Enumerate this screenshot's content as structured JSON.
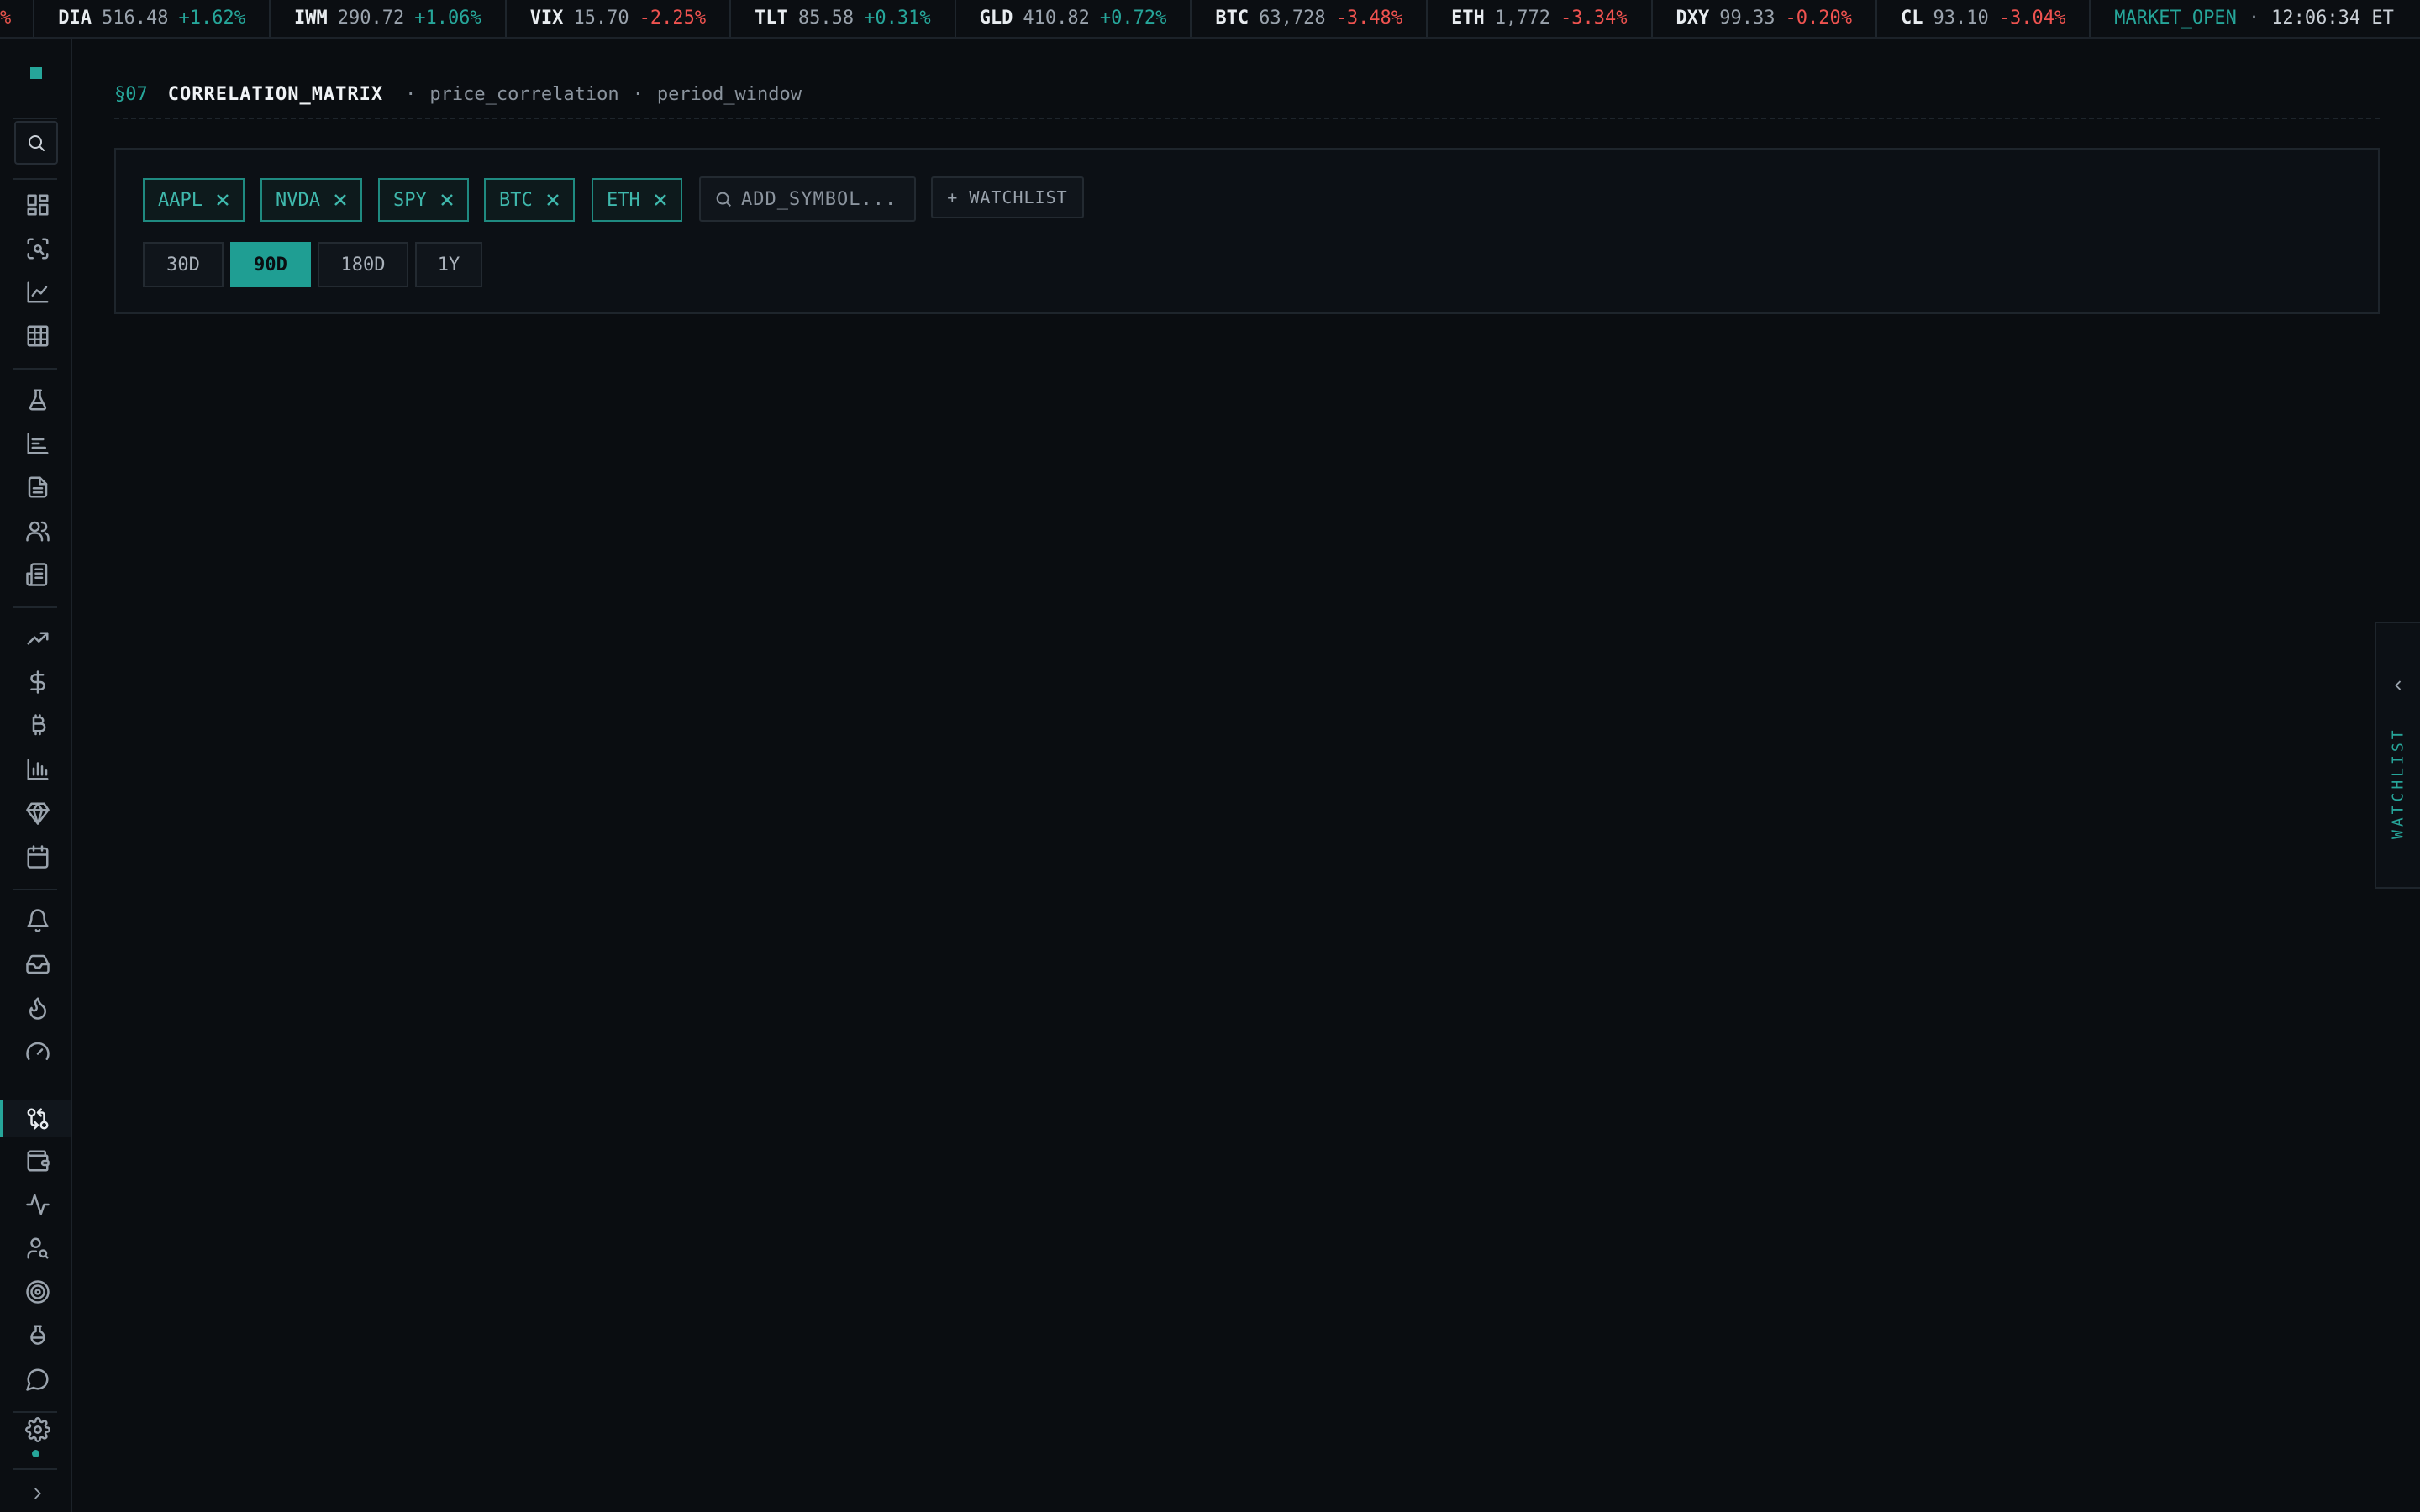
{
  "ticker": {
    "fragment": "%",
    "items": [
      {
        "symbol": "DIA",
        "price": "516.48",
        "change": "+1.62%",
        "dir": "up"
      },
      {
        "symbol": "IWM",
        "price": "290.72",
        "change": "+1.06%",
        "dir": "up"
      },
      {
        "symbol": "VIX",
        "price": "15.70",
        "change": "-2.25%",
        "dir": "down"
      },
      {
        "symbol": "TLT",
        "price": "85.58",
        "change": "+0.31%",
        "dir": "up"
      },
      {
        "symbol": "GLD",
        "price": "410.82",
        "change": "+0.72%",
        "dir": "up"
      },
      {
        "symbol": "BTC",
        "price": "63,728",
        "change": "-3.48%",
        "dir": "down"
      },
      {
        "symbol": "ETH",
        "price": "1,772",
        "change": "-3.34%",
        "dir": "down"
      },
      {
        "symbol": "DXY",
        "price": "99.33",
        "change": "-0.20%",
        "dir": "down"
      },
      {
        "symbol": "CL",
        "price": "93.10",
        "change": "-3.04%",
        "dir": "down"
      }
    ],
    "market_status": "MARKET_OPEN",
    "separator": "·",
    "time": "12:06:34 ET"
  },
  "sidebar": {
    "icons": [
      "dashboard-icon",
      "scan-search-icon",
      "line-chart-icon",
      "grid-table-icon",
      "flask-icon",
      "bar-list-icon",
      "document-icon",
      "users-icon",
      "news-icon",
      "trending-up-icon",
      "dollar-icon",
      "bitcoin-icon",
      "bar-chart-icon",
      "gem-icon",
      "calendar-icon",
      "bell-icon",
      "inbox-icon",
      "flame-icon",
      "gauge-icon",
      "git-compare-icon",
      "wallet-icon",
      "activity-icon",
      "user-search-icon",
      "target-icon",
      "beaker-icon",
      "message-icon",
      "settings-icon"
    ],
    "active": "git-compare-icon"
  },
  "header": {
    "section": "§07",
    "title": "CORRELATION_MATRIX",
    "sep1": "·",
    "sub1": "price_correlation",
    "sep2": "·",
    "sub2": "period_window"
  },
  "symbols": [
    "AAPL",
    "NVDA",
    "SPY",
    "BTC",
    "ETH"
  ],
  "add_symbol": {
    "placeholder": "ADD_SYMBOL..."
  },
  "watchlist_button": "+ WATCHLIST",
  "periods": [
    {
      "label": "30D",
      "active": false
    },
    {
      "label": "90D",
      "active": true
    },
    {
      "label": "180D",
      "active": false
    },
    {
      "label": "1Y",
      "active": false
    }
  ],
  "watchlist_tab": {
    "label": "WATCHLIST"
  },
  "colors": {
    "accent": "#26a69a",
    "up": "#26a69a",
    "down": "#ef5350",
    "background": "#0a0d11"
  }
}
